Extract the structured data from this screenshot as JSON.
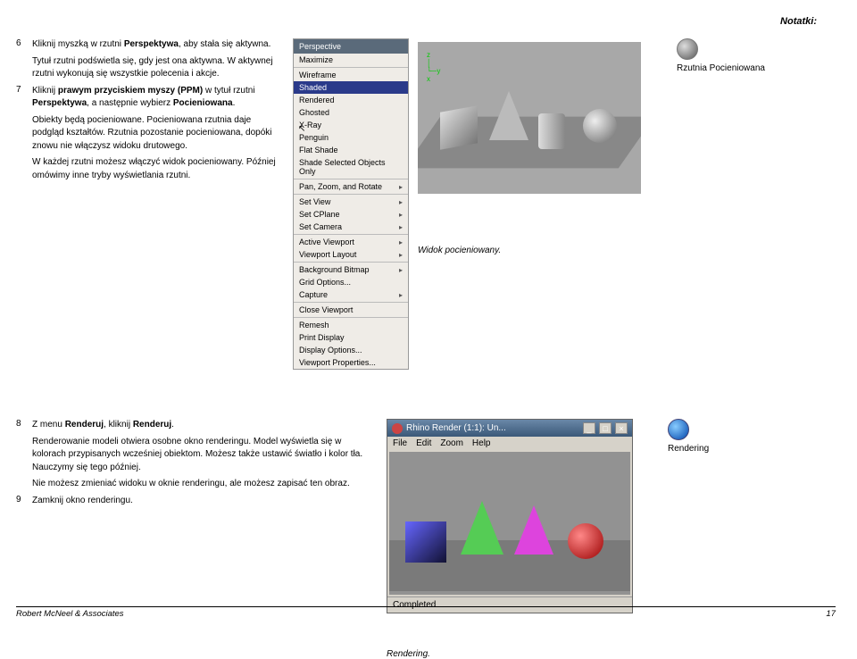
{
  "notes_label": "Notatki:",
  "steps": {
    "s6": {
      "num": "6",
      "text_pre": "Kliknij myszką w rzutni ",
      "bold": "Perspektywa",
      "text_post": ", aby stała się aktywna."
    },
    "s6_sub": "Tytuł rzutni podświetla się, gdy jest ona aktywna. W aktywnej rzutni wykonują się wszystkie polecenia i akcje.",
    "s7": {
      "num": "7",
      "text_pre": "Kliknij ",
      "bold1": "prawym przyciskiem myszy (PPM)",
      "mid": " w tytuł rzutni ",
      "bold2": "Perspektywa",
      "mid2": ", a następnie wybierz ",
      "bold3": "Pocieniowana",
      "post": "."
    },
    "s7_sub1": "Obiekty będą pocieniowane. Pocieniowana rzutnia daje podgląd kształtów. Rzutnia pozostanie pocieniowana, dopóki znowu nie włączysz widoku drutowego.",
    "s7_sub2": "W każdej rzutni możesz włączyć widok pocieniowany. Później omówimy inne tryby wyświetlania rzutni.",
    "s8": {
      "num": "8",
      "text_pre": "Z menu ",
      "bold1": "Renderuj",
      "mid": ", kliknij ",
      "bold2": "Renderuj",
      "post": "."
    },
    "s8_sub1": "Renderowanie modeli otwiera osobne okno renderingu. Model wyświetla się w kolorach przypisanych wcześniej obiektom. Możesz także ustawić światło i kolor tła. Nauczymy się tego później.",
    "s8_sub2": "Nie możesz zmieniać widoku w oknie renderingu, ale możesz zapisać ten obraz.",
    "s9": {
      "num": "9",
      "text": "Zamknij okno renderingu."
    }
  },
  "menu": {
    "title": "Perspective",
    "items1": [
      "Maximize"
    ],
    "items2": [
      "Wireframe",
      "Shaded",
      "Rendered",
      "Ghosted",
      "X-Ray",
      "Penguin",
      "Flat Shade",
      "Shade Selected Objects Only"
    ],
    "items3": [
      "Pan, Zoom, and Rotate"
    ],
    "items4": [
      "Set View",
      "Set CPlane",
      "Set Camera"
    ],
    "items5": [
      "Active Viewport",
      "Viewport Layout"
    ],
    "items6": [
      "Background Bitmap",
      "Grid Options...",
      "Capture"
    ],
    "items7": [
      "Close Viewport"
    ],
    "items8": [
      "Remesh",
      "Print Display",
      "Display Options...",
      "Viewport Properties..."
    ]
  },
  "shaded_caption": "Widok pocieniowany.",
  "sidebar_shaded": "Rzutnia Pocieniowana",
  "sidebar_render": "Rendering",
  "render_win": {
    "title": "Rhino Render (1:1): Un...",
    "menu": [
      "File",
      "Edit",
      "Zoom",
      "Help"
    ],
    "status": "Completed",
    "min": "_",
    "max": "□",
    "close": "×"
  },
  "render_caption": "Rendering.",
  "footer_left": "Robert McNeel & Associates",
  "footer_right": "17"
}
